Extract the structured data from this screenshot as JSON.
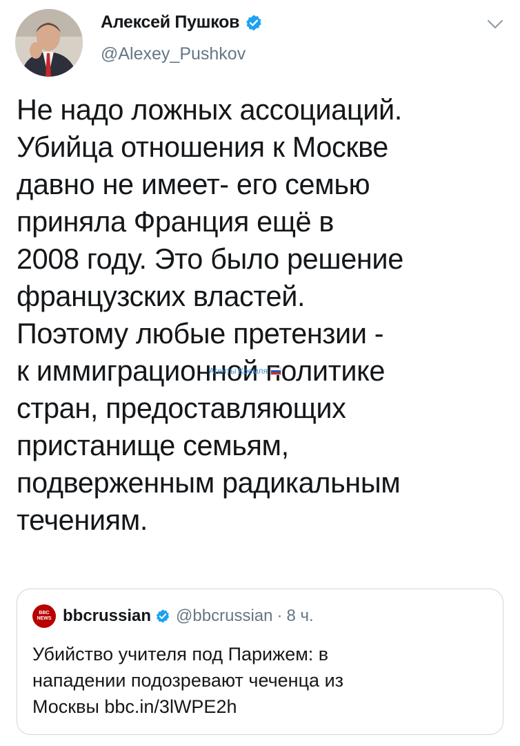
{
  "author": {
    "name": "Алексей Пушков",
    "handle": "@Alexey_Pushkov",
    "verified": true
  },
  "tweet": {
    "text": "Не надо ложных ассоциаций.\nУбийца отношения к Москве\nдавно не имеет- его семью\nприняла Франция ещё в\n2008 году. Это было решение\nфранцузских властей.\nПоэтому любые претензии -\nк иммиграционной политике\nстран, предоставляющих\nпристанище семьям,\nподверженным радикальным\nтечениям."
  },
  "watermark": {
    "text": "Агенты Кремля",
    "flag_icon": "russia-flag-icon"
  },
  "quoted_tweet": {
    "logo_lines": [
      "BBC",
      "NEWS"
    ],
    "name": "bbcrussian",
    "verified": true,
    "handle": "@bbcrussian",
    "separator": "·",
    "time": "8 ч.",
    "text": "Убийство учителя под Парижем: в\nнападении подозревают чеченца из\nМосквы bbc.in/3lWPE2h"
  },
  "colors": {
    "verified_blue": "#1da1f2",
    "text_primary": "#14171a",
    "text_secondary": "#657786",
    "bbc_red": "#b80000",
    "border": "#ccd6dd"
  }
}
